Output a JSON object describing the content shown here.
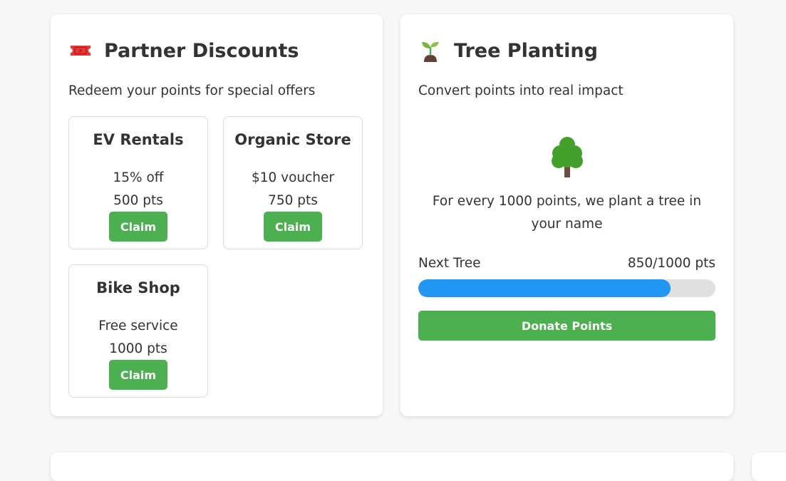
{
  "discounts": {
    "title": "Partner Discounts",
    "title_icon": "ticket-icon",
    "subtitle": "Redeem your points for special offers",
    "offers": [
      {
        "name": "EV Rentals",
        "description": "15% off",
        "points": "500 pts",
        "button": "Claim"
      },
      {
        "name": "Organic Store",
        "description": "$10 voucher",
        "points": "750 pts",
        "button": "Claim"
      },
      {
        "name": "Bike Shop",
        "description": "Free service",
        "points": "1000 pts",
        "button": "Claim"
      }
    ]
  },
  "trees": {
    "title": "Tree Planting",
    "title_icon": "seedling-icon",
    "subtitle": "Convert points into real impact",
    "illustration": "tree-icon",
    "description": "For every 1000 points, we plant a tree in your name",
    "progress_label": "Next Tree",
    "progress_value": "850/1000 pts",
    "progress_fraction": 0.85,
    "button": "Donate Points"
  },
  "colors": {
    "accent_green": "#4caf50",
    "progress_blue": "#2196f3",
    "ticket_red": "#e53935"
  }
}
